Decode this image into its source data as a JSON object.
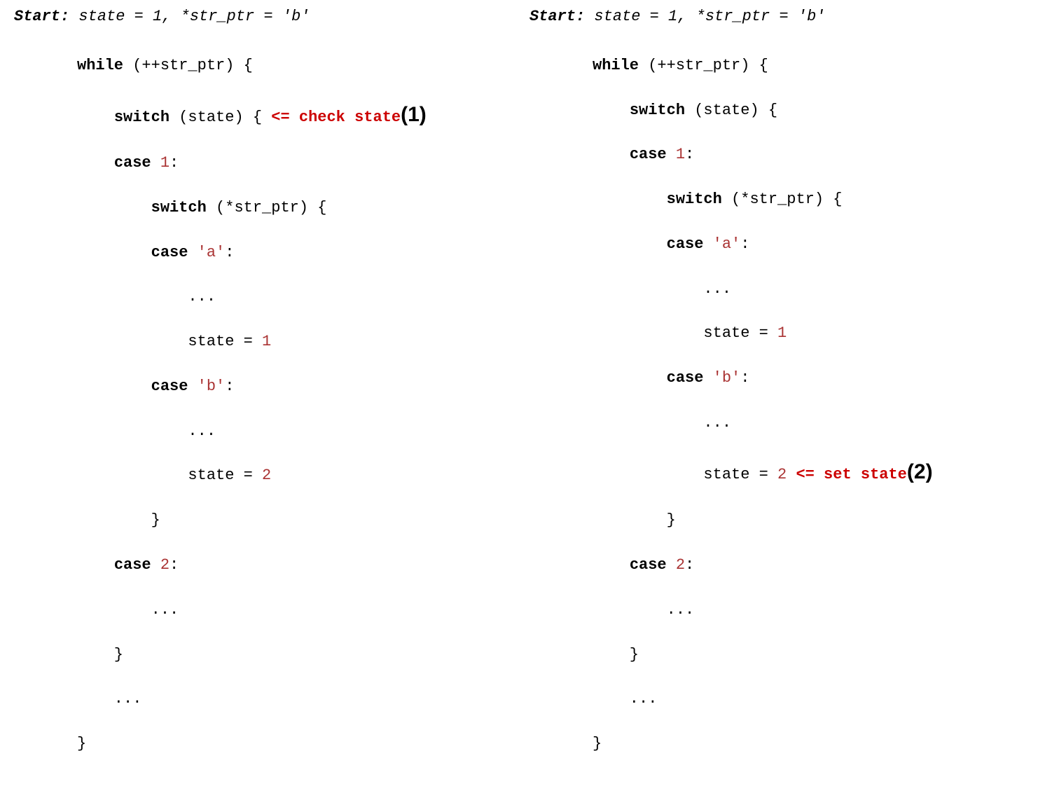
{
  "left": {
    "start_label": "Start:",
    "start_rest": " state = 1, *str_ptr = 'b'",
    "l1_kw": "while",
    "l1_rest": " (++str_ptr) {",
    "l2_indent": "    ",
    "l2_kw": "switch",
    "l2_rest": " (state) { ",
    "annot": "<= check state",
    "step": "(1)",
    "l3_indent": "    ",
    "l3_kw": "case",
    "l3_sp": " ",
    "l3_num": "1",
    "l3_colon": ":",
    "l4_indent": "        ",
    "l4_kw": "switch",
    "l4_rest": " (*str_ptr) {",
    "l5_indent": "        ",
    "l5_kw": "case",
    "l5_sp": " ",
    "l5_str": "'a'",
    "l5_colon": ":",
    "l6": "            ...",
    "l7_indent": "            state = ",
    "l7_num": "1",
    "l8_indent": "        ",
    "l8_kw": "case",
    "l8_sp": " ",
    "l8_str": "'b'",
    "l8_colon": ":",
    "l9": "            ...",
    "l10_indent": "            state = ",
    "l10_num": "2",
    "l11": "        }",
    "l12_indent": "    ",
    "l12_kw": "case",
    "l12_sp": " ",
    "l12_num": "2",
    "l12_colon": ":",
    "l13": "        ...",
    "l14": "    }",
    "l15": "    ...",
    "l16": "}"
  },
  "right": {
    "start_label": "Start:",
    "start_rest": " state = 1, *str_ptr = 'b'",
    "l1_kw": "while",
    "l1_rest": " (++str_ptr) {",
    "l2_indent": "    ",
    "l2_kw": "switch",
    "l2_rest": " (state) {",
    "l3_indent": "    ",
    "l3_kw": "case",
    "l3_sp": " ",
    "l3_num": "1",
    "l3_colon": ":",
    "l4_indent": "        ",
    "l4_kw": "switch",
    "l4_rest": " (*str_ptr) {",
    "l5_indent": "        ",
    "l5_kw": "case",
    "l5_sp": " ",
    "l5_str": "'a'",
    "l5_colon": ":",
    "l6": "            ...",
    "l7_indent": "            state = ",
    "l7_num": "1",
    "l8_indent": "        ",
    "l8_kw": "case",
    "l8_sp": " ",
    "l8_str": "'b'",
    "l8_colon": ":",
    "l9": "            ...",
    "l10_indent": "            state = ",
    "l10_num": "2",
    "l10_sp": " ",
    "annot": "<= set state",
    "step": "(2)",
    "l11": "        }",
    "l12_indent": "    ",
    "l12_kw": "case",
    "l12_sp": " ",
    "l12_num": "2",
    "l12_colon": ":",
    "l13": "        ...",
    "l14": "    }",
    "l15": "    ...",
    "l16": "}"
  }
}
